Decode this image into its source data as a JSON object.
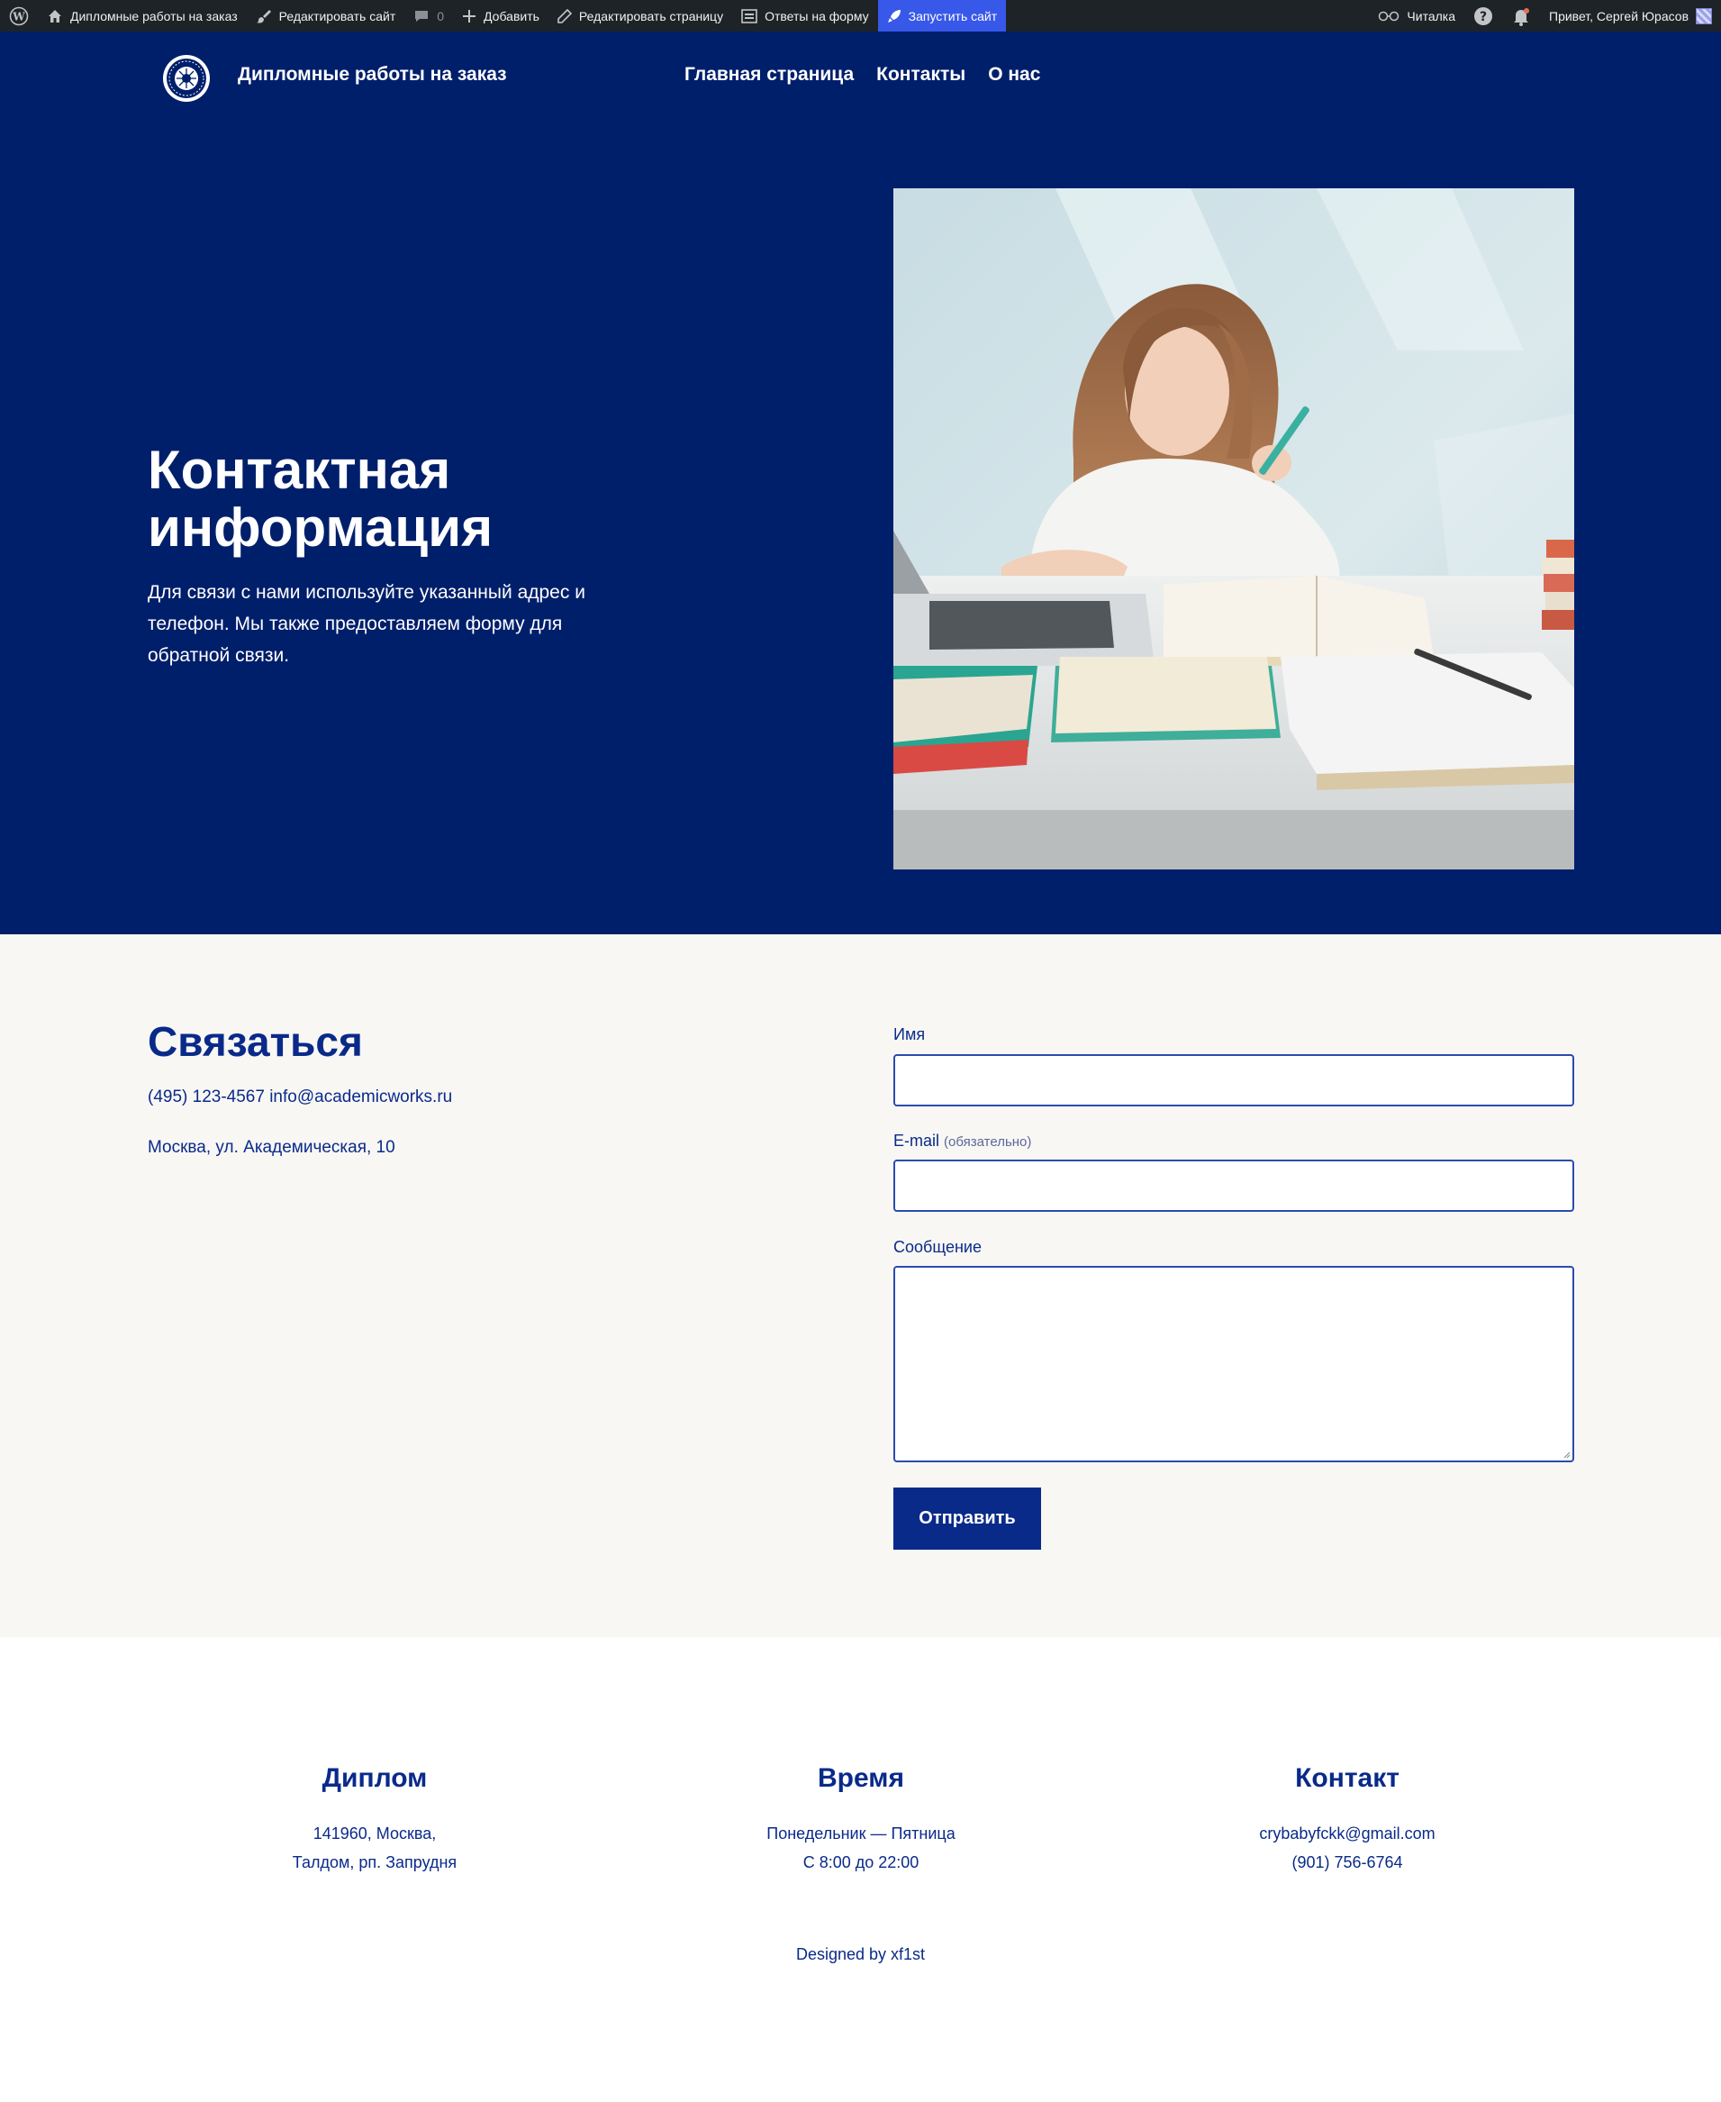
{
  "admin_bar": {
    "site_name": "Дипломные работы на заказ",
    "edit_site": "Редактировать сайт",
    "comments_count": "0",
    "add_new": "Добавить",
    "edit_page": "Редактировать страницу",
    "form_responses": "Ответы на форму",
    "launch_site": "Запустить сайт",
    "reader": "Читалка",
    "greeting": "Привет, Сергей Юрасов"
  },
  "header": {
    "site_title": "Дипломные работы на заказ",
    "nav": [
      "Главная страница",
      "Контакты",
      "О нас"
    ]
  },
  "hero": {
    "title": "Контактная информация",
    "text": "Для связи с нами используйте указанный адрес и телефон. Мы также предоставляем форму для обратной связи."
  },
  "contact": {
    "heading": "Связаться",
    "phone_email": "(495) 123-4567 info@academicworks.ru",
    "address": "Москва, ул. Академическая, 10",
    "form": {
      "name_label": "Имя",
      "email_label": "E-mail",
      "email_required": "(обязательно)",
      "message_label": "Сообщение",
      "submit": "Отправить"
    }
  },
  "footer": {
    "col1": {
      "title": "Диплом",
      "line1": "141960, Москва,",
      "line2": "Талдом, рп. Запрудня"
    },
    "col2": {
      "title": "Время",
      "line1": "Понедельник — Пятница",
      "line2": "С 8:00 до 22:00"
    },
    "col3": {
      "title": "Контакт",
      "line1": "crybabyfckk@gmail.com",
      "line2": "(901) 756-6764"
    },
    "credit": "Designed by xf1st"
  },
  "colors": {
    "navy": "#001f6b",
    "accent": "#0a2a8a",
    "admin_bar": "#1d2327",
    "launch_highlight": "#3858e9",
    "section_bg": "#f8f7f4"
  }
}
